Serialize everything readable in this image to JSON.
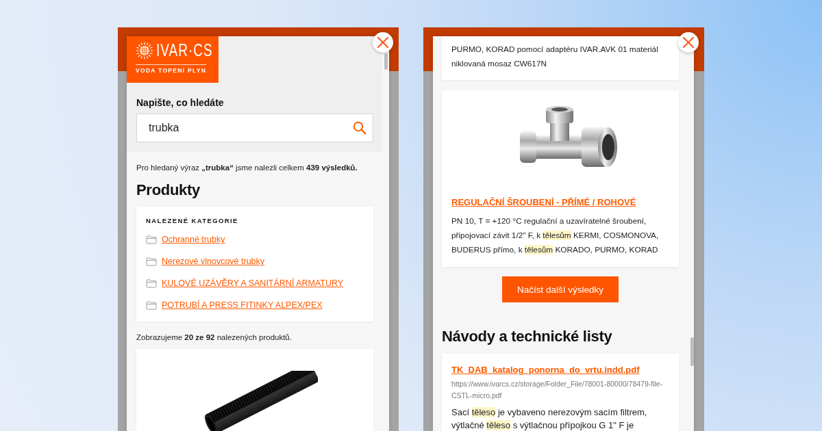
{
  "left_screen": {
    "logo": {
      "name": "IVAR·CS",
      "tagline": "VODA TOPENÍ PLYN"
    },
    "search": {
      "label": "Napište, co hledáte",
      "value": "trubka"
    },
    "results_summary": "Pro hledaný výraz **„trubka“** jsme nalezli celkem **439 výsledků.**",
    "products_heading": "Produkty",
    "categories": {
      "title": "NALEZENÉ KATEGORIE",
      "items": [
        "Ochranné trubky",
        "Nerezové vlnovcové trubky",
        "KULOVÉ UZÁVĚRY A SANITÁRNÍ ARMATURY",
        "POTRUBÍ A PRESS FITINKY ALPEX/PEX"
      ]
    },
    "products_summary": "Zobrazujeme **20 ze 92** nalezených produktů.",
    "product_photo": {
      "kind": "pipe"
    }
  },
  "right_screen": {
    "previous_card_text": "PURMO, KORAD pomocí adaptéru IVAR.AVK 01 materiál niklovaná mosaz CW617N",
    "product": {
      "photo": {
        "kind": "valve"
      },
      "title": "REGULAČNÍ ŠROUBENÍ - PŘÍMÉ / ROHOVÉ",
      "description": [
        {
          "text": "PN 10, T = +120 °C regulační a uzavíratelné šroubení, připojovací závit 1/2\" F, k ",
          "highlight": false
        },
        {
          "text": "tělesům",
          "highlight": true
        },
        {
          "text": " KERMI, COSMONOVA, BUDERUS přímo, k ",
          "highlight": false
        },
        {
          "text": "tělesům",
          "highlight": true
        },
        {
          "text": " KORADO, PURMO, KORAD",
          "highlight": false
        }
      ]
    },
    "load_more_button": "Načíst další výsledky",
    "documents_heading": "Návody a technické listy",
    "documents": [
      {
        "title": "TK_DAB_katalog_ponorna_do_vrtu.indd.pdf",
        "url": "https://www.ivarcs.cz/storage/Folder_File/78001-80000/78479-file-CSTL-micro.pdf",
        "excerpt": [
          {
            "text": "Sací ",
            "highlight": false
          },
          {
            "text": "těleso",
            "highlight": true
          },
          {
            "text": " je vybaveno nerezovým sacím filtrem, výtlačné ",
            "highlight": false
          },
          {
            "text": "těleso",
            "highlight": true
          },
          {
            "text": " s výtlačnou přípojkou G 1\" F je",
            "highlight": false
          }
        ]
      }
    ]
  }
}
